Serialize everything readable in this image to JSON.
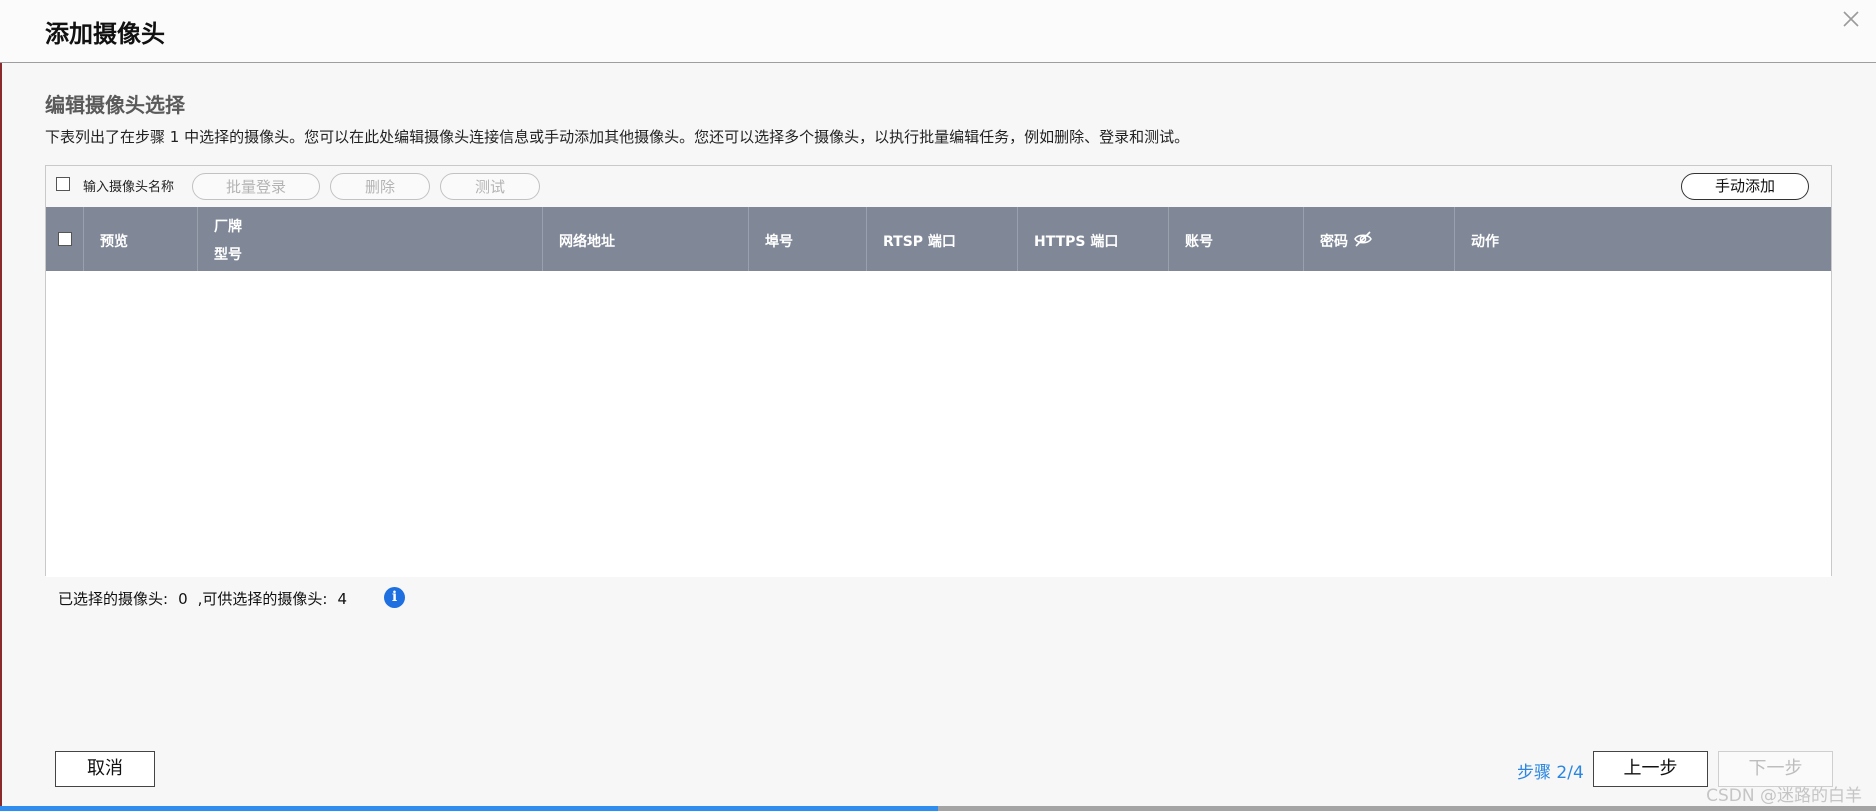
{
  "dialog": {
    "title": "添加摄像头",
    "close_icon": "close-icon"
  },
  "section": {
    "title": "编辑摄像头选择",
    "description": "下表列出了在步骤 1 中选择的摄像头。您可以在此处编辑摄像头连接信息或手动添加其他摄像头。您还可以选择多个摄像头，以执行批量编辑任务，例如删除、登录和测试。"
  },
  "toolbar": {
    "checkbox_label": "输入摄像头名称",
    "batch_login_label": "批量登录",
    "delete_label": "删除",
    "test_label": "测试",
    "manual_add_label": "手动添加"
  },
  "table": {
    "columns": {
      "preview": "预览",
      "brand": "厂牌",
      "model": "型号",
      "ip": "网络地址",
      "port": "埠号",
      "rtsp": "RTSP 端口",
      "https": "HTTPS 端口",
      "account": "账号",
      "password": "密码",
      "action": "动作"
    },
    "rows": []
  },
  "selection": {
    "selected_label": "已选择的摄像头:",
    "selected_count": "0",
    "available_label": ",可供选择的摄像头:",
    "available_count": "4"
  },
  "footer": {
    "cancel_label": "取消",
    "step_label": "步骤 2/4",
    "prev_label": "上一步",
    "next_label": "下一步",
    "watermark": "CSDN @迷路的白羊"
  },
  "progress": {
    "fraction": 0.5
  },
  "colors": {
    "accent": "#2f8df0",
    "header_bg": "#808898",
    "info_icon": "#1e6fe0",
    "step_text": "#2a86e0"
  }
}
